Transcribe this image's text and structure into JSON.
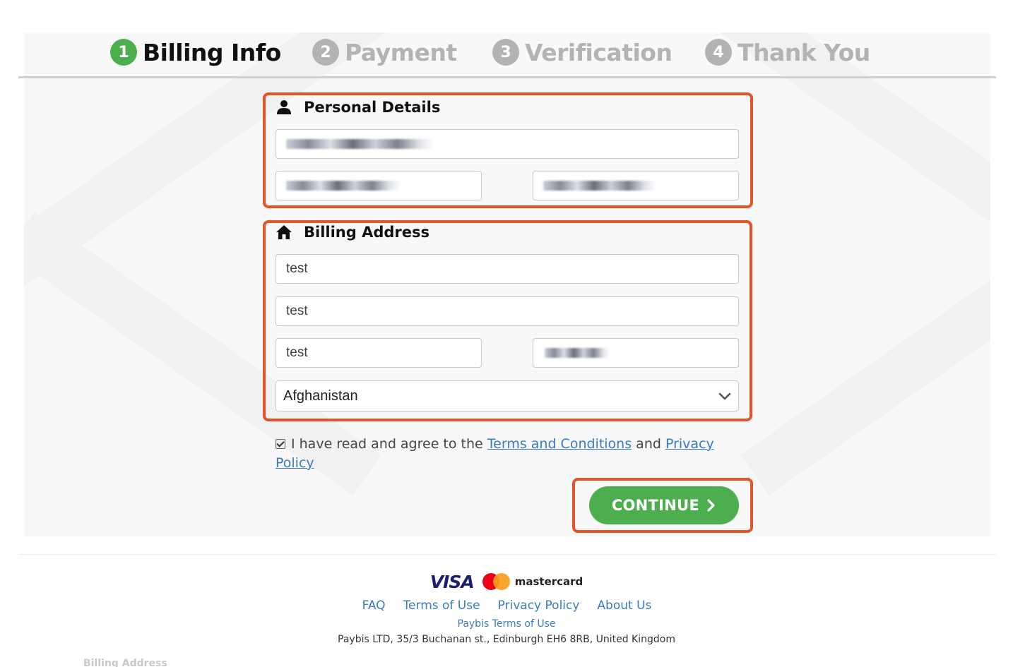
{
  "stepper": {
    "steps": [
      {
        "number": "1",
        "label": "Billing Info",
        "state": "active"
      },
      {
        "number": "2",
        "label": "Payment",
        "state": "inactive"
      },
      {
        "number": "3",
        "label": "Verification",
        "state": "inactive"
      },
      {
        "number": "4",
        "label": "Thank You",
        "state": "inactive"
      }
    ]
  },
  "personal": {
    "title": "Personal Details",
    "icon": "user-icon"
  },
  "billing": {
    "title": "Billing Address",
    "icon": "home-icon",
    "address_line1": "test",
    "address_line2": "test",
    "city": "test",
    "country": "Afghanistan"
  },
  "agree": {
    "prefix": "I have read and agree to the",
    "terms_link": "Terms and Conditions",
    "and": "and",
    "privacy_link": "Privacy Policy",
    "checked": true
  },
  "continue_label": "CONTINUE",
  "footer": {
    "visa": "VISA",
    "mastercard": "mastercard",
    "links": [
      "FAQ",
      "Terms of Use",
      "Privacy Policy",
      "About Us"
    ],
    "paybis_terms": "Paybis Terms of Use",
    "address": "Paybis LTD, 35/3 Buchanan st., Edinburgh EH6 8RB, United Kingdom",
    "ghost_text": "Billing Address"
  },
  "colors": {
    "accent_green": "#4cae4c",
    "highlight_red": "#e5532b",
    "link_blue": "#3a7bbf",
    "inactive_gray": "#b3b3b3"
  }
}
